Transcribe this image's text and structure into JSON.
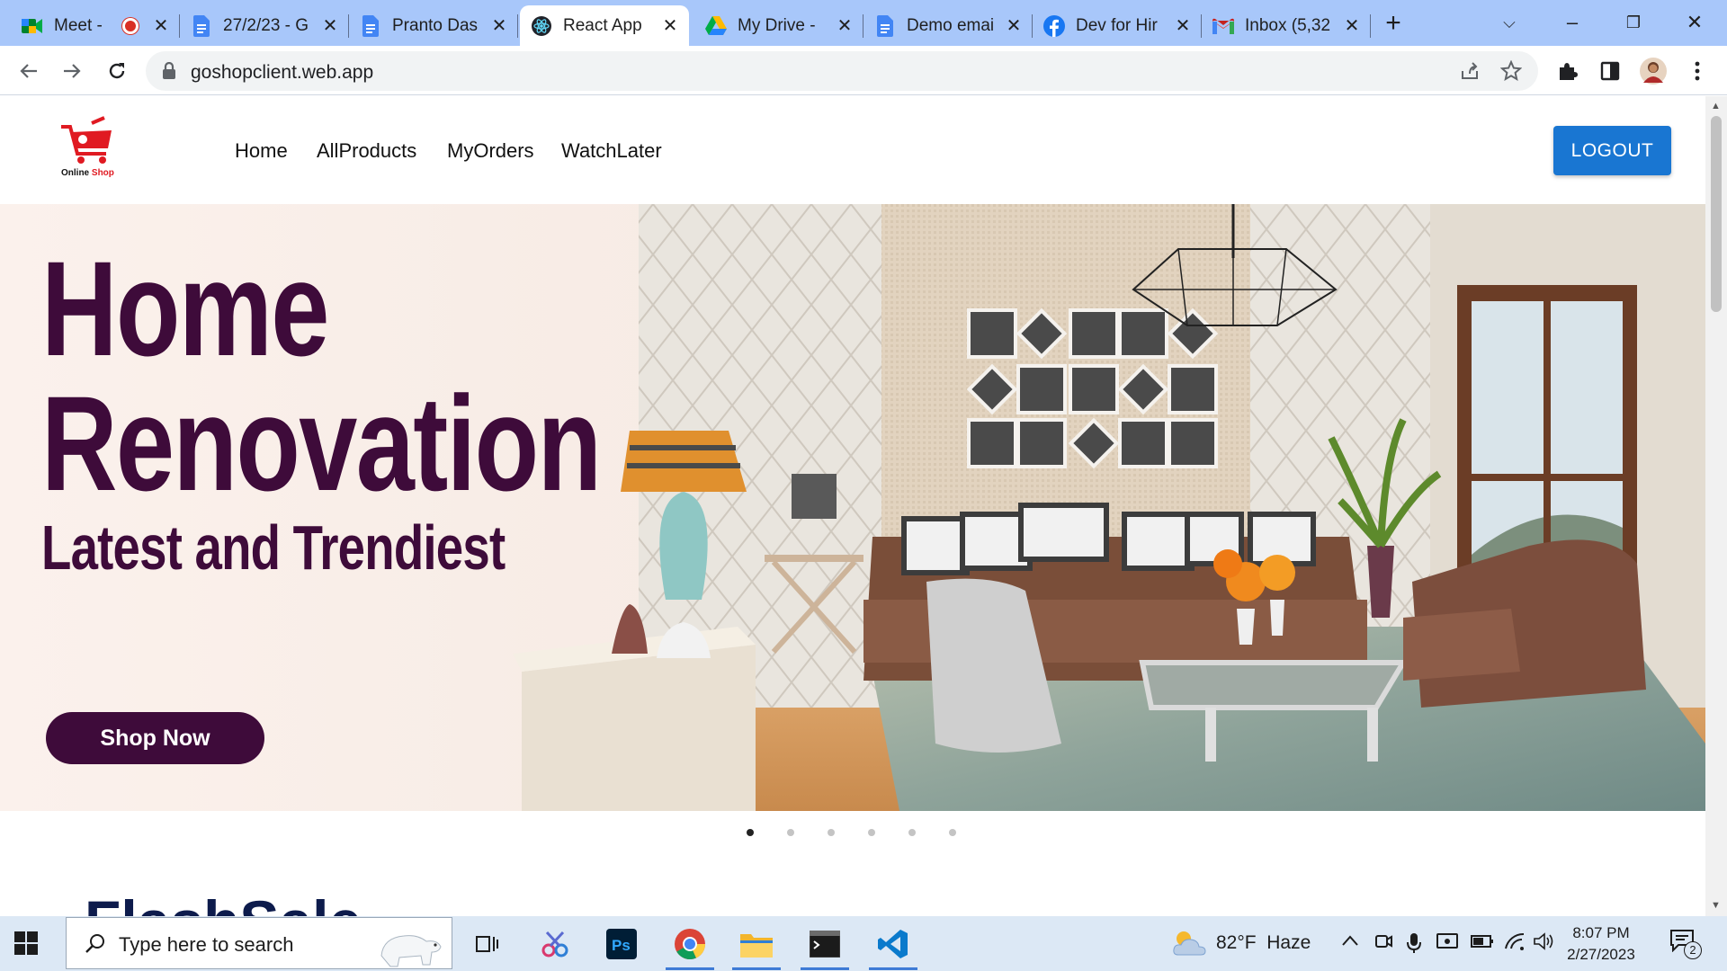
{
  "browser": {
    "tabs": [
      {
        "title": "Meet -",
        "icon": "google-meet-icon"
      },
      {
        "title": "27/2/23 - G",
        "icon": "google-docs-icon"
      },
      {
        "title": "Pranto Das",
        "icon": "google-docs-icon"
      },
      {
        "title": "React App",
        "icon": "react-icon",
        "active": true
      },
      {
        "title": "My Drive -",
        "icon": "google-drive-icon"
      },
      {
        "title": "Demo emai",
        "icon": "google-docs-icon"
      },
      {
        "title": "Dev for Hir",
        "icon": "facebook-icon"
      },
      {
        "title": "Inbox (5,32",
        "icon": "gmail-icon"
      }
    ],
    "new_tab": "+",
    "url": "goshopclient.web.app"
  },
  "site": {
    "logo_text_1": "Online",
    "logo_text_2": "Shop",
    "nav": [
      "Home",
      "AllProducts",
      "MyOrders",
      "WatchLater"
    ],
    "logout_label": "LOGOUT"
  },
  "hero": {
    "line1": "Home",
    "line2": "Renovation",
    "line3": "Latest and Trendiest",
    "cta": "Shop Now",
    "slide_count": 6,
    "active_slide": 1,
    "colors": {
      "headline": "#3e0b3a",
      "background": "#f7ece6"
    }
  },
  "section": {
    "title": "FlashSale"
  },
  "taskbar": {
    "search_placeholder": "Type here to search",
    "weather": "82°F  Haze",
    "time": "8:07 PM",
    "date": "2/27/2023",
    "notifications": "2"
  },
  "colors": {
    "accent": "#1976d2",
    "tabstrip": "#a8c7fa"
  }
}
